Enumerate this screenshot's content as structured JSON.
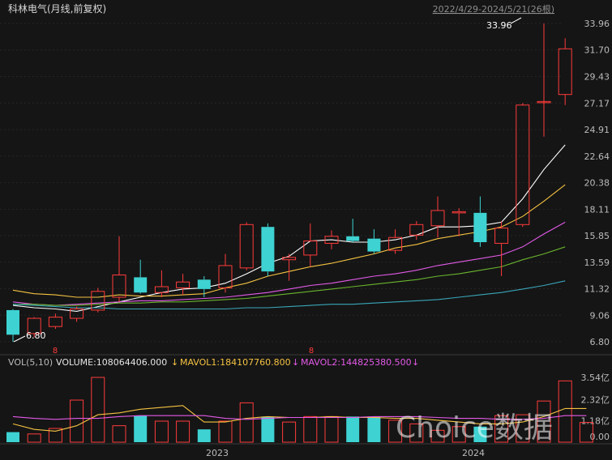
{
  "title": "科林电气(月线,前复权)",
  "date_range": "2022/4/29-2024/5/21(26根)",
  "price_axis": {
    "ticks": [
      "33.96",
      "31.70",
      "29.43",
      "27.17",
      "24.91",
      "22.64",
      "20.38",
      "18.11",
      "15.85",
      "13.59",
      "11.32",
      "9.06",
      "6.80"
    ],
    "min": 6.8,
    "max": 33.96
  },
  "annotations": {
    "high_label": "33.96",
    "low_label": "6.80",
    "marker_symbol": "8"
  },
  "volume_header": {
    "label": "VOL(5,10)",
    "volume": "VOLUME:108064406.000",
    "mavol1": "MAVOL1:184107760.800",
    "mavol2": "MAVOL2:144825380.500",
    "arrow": "↓"
  },
  "volume_axis": {
    "ticks": [
      "3.54亿",
      "2.32亿",
      "1.18亿",
      "0.00"
    ],
    "max_yi": 3.54
  },
  "x_axis_labels": [
    "2023",
    "2024"
  ],
  "watermark": "Choice数据",
  "colors": {
    "background": "#151515",
    "up": "#ff3b3b",
    "down": "#3ed2d2",
    "ma5": "#ffffff",
    "ma10": "#f5c342",
    "ma20": "#e35ae8",
    "ma30": "#6ab52e",
    "ma60": "#3aa6b9",
    "mavol1": "#f5c342",
    "mavol2": "#e35ae8"
  },
  "chart_data": {
    "type": "candlestick",
    "period": "monthly",
    "candles": [
      {
        "o": 9.5,
        "h": 9.6,
        "l": 6.8,
        "c": 7.4
      },
      {
        "o": 7.5,
        "h": 8.9,
        "l": 7.2,
        "c": 8.8
      },
      {
        "o": 8.1,
        "h": 9.2,
        "l": 7.9,
        "c": 8.9
      },
      {
        "o": 8.8,
        "h": 9.8,
        "l": 8.5,
        "c": 9.6
      },
      {
        "o": 9.5,
        "h": 11.4,
        "l": 9.3,
        "c": 11.1
      },
      {
        "o": 10.6,
        "h": 15.8,
        "l": 10.2,
        "c": 12.5
      },
      {
        "o": 12.3,
        "h": 13.8,
        "l": 10.9,
        "c": 11.0
      },
      {
        "o": 11.0,
        "h": 12.9,
        "l": 10.6,
        "c": 11.5
      },
      {
        "o": 11.4,
        "h": 12.6,
        "l": 10.8,
        "c": 11.9
      },
      {
        "o": 12.1,
        "h": 12.4,
        "l": 10.6,
        "c": 11.3
      },
      {
        "o": 11.4,
        "h": 14.3,
        "l": 11.0,
        "c": 13.3
      },
      {
        "o": 13.1,
        "h": 17.0,
        "l": 12.9,
        "c": 16.8
      },
      {
        "o": 16.6,
        "h": 16.9,
        "l": 12.4,
        "c": 12.8
      },
      {
        "o": 13.8,
        "h": 14.3,
        "l": 12.0,
        "c": 14.0
      },
      {
        "o": 14.2,
        "h": 16.9,
        "l": 13.2,
        "c": 15.4
      },
      {
        "o": 15.2,
        "h": 16.3,
        "l": 14.7,
        "c": 15.8
      },
      {
        "o": 15.8,
        "h": 17.3,
        "l": 15.3,
        "c": 15.4
      },
      {
        "o": 15.6,
        "h": 16.4,
        "l": 14.3,
        "c": 14.5
      },
      {
        "o": 14.6,
        "h": 16.4,
        "l": 14.3,
        "c": 15.7
      },
      {
        "o": 15.9,
        "h": 17.1,
        "l": 15.5,
        "c": 16.8
      },
      {
        "o": 16.7,
        "h": 19.2,
        "l": 15.7,
        "c": 18.0
      },
      {
        "o": 17.8,
        "h": 18.2,
        "l": 15.8,
        "c": 17.9
      },
      {
        "o": 17.8,
        "h": 19.2,
        "l": 14.9,
        "c": 15.3
      },
      {
        "o": 15.2,
        "h": 17.1,
        "l": 12.4,
        "c": 16.5
      },
      {
        "o": 16.8,
        "h": 27.17,
        "l": 16.6,
        "c": 27.0
      },
      {
        "o": 27.3,
        "h": 33.96,
        "l": 24.3,
        "c": 27.3
      },
      {
        "o": 27.9,
        "h": 32.7,
        "l": 27.0,
        "c": 31.8
      }
    ],
    "ma_lines": [
      {
        "name": "ma5",
        "values": [
          9.9,
          9.7,
          9.6,
          9.4,
          9.8,
          10.2,
          10.6,
          11.0,
          11.3,
          11.4,
          11.8,
          12.6,
          13.5,
          14.1,
          15.4,
          15.5,
          15.3,
          15.3,
          15.5,
          15.9,
          16.6,
          16.6,
          16.7,
          17.0,
          19.0,
          21.5,
          23.6
        ]
      },
      {
        "name": "ma10",
        "values": [
          11.2,
          10.9,
          10.8,
          10.6,
          10.6,
          10.8,
          10.7,
          10.7,
          10.8,
          10.9,
          11.4,
          11.8,
          12.4,
          12.8,
          13.2,
          13.5,
          13.9,
          14.3,
          14.8,
          15.1,
          15.6,
          15.9,
          16.2,
          16.6,
          17.5,
          18.8,
          20.2
        ]
      },
      {
        "name": "ma20",
        "values": [
          10.2,
          10.0,
          9.9,
          10.0,
          10.1,
          10.2,
          10.3,
          10.3,
          10.4,
          10.5,
          10.6,
          10.8,
          11.0,
          11.3,
          11.6,
          11.8,
          12.1,
          12.4,
          12.6,
          12.9,
          13.3,
          13.6,
          13.9,
          14.2,
          14.9,
          16.0,
          17.0
        ]
      },
      {
        "name": "ma30",
        "values": [
          10.0,
          10.0,
          9.9,
          9.9,
          10.0,
          10.1,
          10.1,
          10.2,
          10.2,
          10.3,
          10.4,
          10.5,
          10.7,
          10.9,
          11.1,
          11.3,
          11.5,
          11.7,
          11.9,
          12.1,
          12.4,
          12.6,
          12.9,
          13.2,
          13.8,
          14.3,
          14.9
        ]
      },
      {
        "name": "ma60",
        "values": [
          10.0,
          9.9,
          9.8,
          9.7,
          9.7,
          9.6,
          9.6,
          9.6,
          9.6,
          9.6,
          9.6,
          9.7,
          9.7,
          9.8,
          9.9,
          10.0,
          10.0,
          10.1,
          10.2,
          10.3,
          10.4,
          10.6,
          10.8,
          11.0,
          11.3,
          11.6,
          12.0
        ]
      }
    ],
    "volume_yi": [
      0.55,
      0.45,
      0.75,
      2.3,
      3.54,
      0.9,
      1.45,
      1.15,
      1.15,
      0.7,
      1.15,
      2.15,
      1.4,
      1.1,
      1.4,
      1.4,
      1.4,
      1.4,
      1.2,
      1.0,
      0.65,
      0.85,
      0.85,
      1.45,
      1.5,
      2.25,
      3.35,
      1.08
    ],
    "mavol1_yi": [
      1.0,
      0.7,
      0.6,
      0.9,
      1.5,
      1.6,
      1.8,
      1.9,
      2.0,
      1.1,
      1.1,
      1.3,
      1.4,
      1.35,
      1.35,
      1.4,
      1.35,
      1.35,
      1.3,
      1.3,
      1.2,
      1.1,
      1.0,
      1.0,
      1.1,
      1.4,
      1.84,
      1.84
    ],
    "mavol2_yi": [
      1.4,
      1.3,
      1.25,
      1.3,
      1.3,
      1.4,
      1.45,
      1.45,
      1.45,
      1.45,
      1.3,
      1.25,
      1.3,
      1.35,
      1.35,
      1.35,
      1.35,
      1.4,
      1.4,
      1.4,
      1.35,
      1.3,
      1.3,
      1.25,
      1.25,
      1.3,
      1.45,
      1.45
    ]
  }
}
